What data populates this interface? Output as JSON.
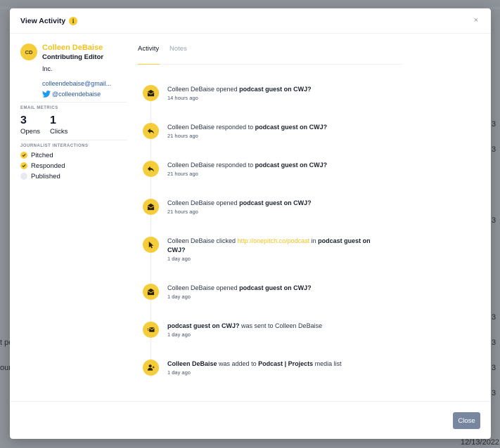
{
  "background": {
    "fragments": [
      "3",
      "3",
      "3",
      "3",
      "3",
      "t po",
      "3",
      "our",
      "3",
      "12/13/2022"
    ]
  },
  "modal": {
    "title": "View Activity",
    "info_glyph": "i",
    "close_glyph": "×",
    "close_button_label": "Close"
  },
  "contact": {
    "initials": "CD",
    "name": "Colleen DeBaise",
    "role": "Contributing Editor",
    "company": "Inc.",
    "email": "colleendebaise@gmail...",
    "twitter": "@colleendebaise"
  },
  "metrics": {
    "section_label": "EMAIL METRICS",
    "opens_count": "3",
    "opens_label": "Opens",
    "clicks_count": "1",
    "clicks_label": "Clicks"
  },
  "interactions": {
    "section_label": "JOURNALIST INTERACTIONS",
    "items": [
      {
        "label": "Pitched",
        "checked": true
      },
      {
        "label": "Responded",
        "checked": true
      },
      {
        "label": "Published",
        "checked": false
      }
    ]
  },
  "tabs": [
    {
      "label": "Activity",
      "active": true
    },
    {
      "label": "Notes",
      "active": false
    }
  ],
  "events": [
    {
      "icon": "envelope-open-icon",
      "parts": [
        {
          "t": "Colleen DeBaise opened "
        },
        {
          "t": "podcast guest on CWJ?",
          "b": true
        }
      ],
      "time": "14 hours ago"
    },
    {
      "icon": "reply-icon",
      "parts": [
        {
          "t": "Colleen DeBaise responded to "
        },
        {
          "t": "podcast guest on CWJ?",
          "b": true
        }
      ],
      "time": "21 hours ago"
    },
    {
      "icon": "reply-icon",
      "parts": [
        {
          "t": "Colleen DeBaise responded to "
        },
        {
          "t": "podcast guest on CWJ?",
          "b": true
        }
      ],
      "time": "21 hours ago"
    },
    {
      "icon": "envelope-open-icon",
      "parts": [
        {
          "t": "Colleen DeBaise opened "
        },
        {
          "t": "podcast guest on CWJ?",
          "b": true
        }
      ],
      "time": "21 hours ago"
    },
    {
      "icon": "cursor-click-icon",
      "parts": [
        {
          "t": "Colleen DeBaise clicked "
        },
        {
          "t": "http://onepitch.co/podcast",
          "link": true
        },
        {
          "t": " in "
        },
        {
          "t": "podcast guest on CWJ?",
          "b": true
        }
      ],
      "time": "1 day ago"
    },
    {
      "icon": "envelope-open-icon",
      "parts": [
        {
          "t": "Colleen DeBaise opened "
        },
        {
          "t": "podcast guest on CWJ?",
          "b": true
        }
      ],
      "time": "1 day ago"
    },
    {
      "icon": "send-mail-icon",
      "parts": [
        {
          "t": "podcast guest on CWJ?",
          "b": true
        },
        {
          "t": " was sent to Colleen DeBaise"
        }
      ],
      "time": "1 day ago"
    },
    {
      "icon": "user-added-icon",
      "parts": [
        {
          "t": "Colleen DeBaise",
          "b": true
        },
        {
          "t": " was added to "
        },
        {
          "t": "Podcast | Projects",
          "b": true
        },
        {
          "t": " media list"
        }
      ],
      "time": "1 day ago"
    }
  ],
  "colors": {
    "accent_yellow": "#f5cd3b",
    "link_blue": "#2b5aa0",
    "button_slate": "#7886a0"
  }
}
